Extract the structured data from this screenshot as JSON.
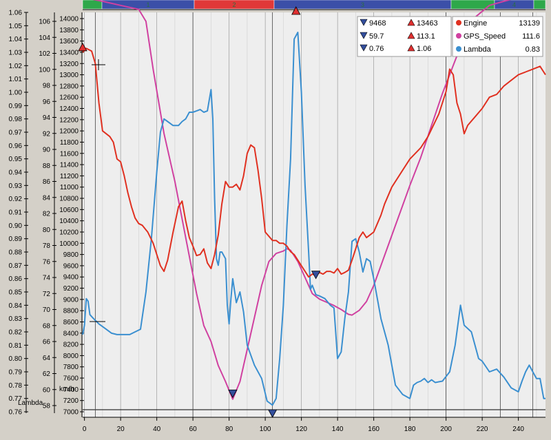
{
  "segments_bar": [
    {
      "label": "1",
      "color": "#3b4fa8"
    },
    {
      "label": "2",
      "color": "#e03838"
    },
    {
      "label": "3",
      "color": "#3b4fa8"
    },
    {
      "label": "4",
      "color": "#3b4fa8"
    }
  ],
  "stats_box": {
    "rows": [
      {
        "min": "9468",
        "max": "13463"
      },
      {
        "min": "59.7",
        "max": "113.1"
      },
      {
        "min": "0.76",
        "max": "1.06"
      }
    ]
  },
  "legend": [
    {
      "name": "Engine",
      "value": "13139",
      "color": "#e03020"
    },
    {
      "name": "GPS_Speed",
      "value": "111.6",
      "color": "#d040a0"
    },
    {
      "name": "Lambda",
      "value": "0.83",
      "color": "#3a8fd0"
    }
  ],
  "axes": {
    "lambda_label": "Lambda",
    "speed_label": "km/h"
  },
  "chart_data": {
    "type": "line",
    "x_ticks": [
      0,
      20,
      40,
      60,
      80,
      100,
      120,
      140,
      160,
      180,
      200,
      220,
      240
    ],
    "xlim": [
      -1,
      255
    ],
    "lambda_axis": {
      "ylim": [
        0.76,
        1.06
      ],
      "ticks": [
        "1.06",
        "1.05",
        "1.04",
        "1.03",
        "1.02",
        "1.01",
        "1.00",
        "0.99",
        "0.98",
        "0.97",
        "0.96",
        "0.95",
        "0.94",
        "0.93",
        "0.92",
        "0.91",
        "0.90",
        "0.89",
        "0.88",
        "0.87",
        "0.86",
        "0.85",
        "0.84",
        "0.83",
        "0.82",
        "0.81",
        "0.80",
        "0.79",
        "0.78",
        "0.77",
        "0.76"
      ]
    },
    "speed_axis": {
      "ylim": [
        57,
        107
      ],
      "ticks": [
        58,
        60,
        62,
        64,
        66,
        68,
        70,
        72,
        74,
        76,
        78,
        80,
        82,
        84,
        86,
        88,
        90,
        92,
        94,
        96,
        98,
        100,
        102,
        104,
        106
      ]
    },
    "engine_axis": {
      "ylim": [
        7000,
        14000
      ],
      "ticks": [
        7000,
        7200,
        7400,
        7600,
        7800,
        8000,
        8200,
        8400,
        8600,
        8800,
        9000,
        9200,
        9400,
        9600,
        9800,
        10000,
        10200,
        10400,
        10600,
        10800,
        11000,
        11200,
        11400,
        11600,
        11800,
        12000,
        12200,
        12400,
        12600,
        12800,
        13000,
        13200,
        13400,
        13600,
        13800,
        14000
      ]
    },
    "segment_dividers": [
      6,
      60,
      104,
      200,
      230,
      248
    ],
    "series": [
      {
        "name": "Engine",
        "color": "#e03020",
        "axis": "engine",
        "points": [
          [
            -1,
            13400
          ],
          [
            1,
            13470
          ],
          [
            4,
            13420
          ],
          [
            6,
            13200
          ],
          [
            8,
            12500
          ],
          [
            10,
            12000
          ],
          [
            14,
            11900
          ],
          [
            16,
            11800
          ],
          [
            18,
            11500
          ],
          [
            20,
            11450
          ],
          [
            22,
            11200
          ],
          [
            24,
            10900
          ],
          [
            26,
            10650
          ],
          [
            28,
            10450
          ],
          [
            30,
            10350
          ],
          [
            32,
            10320
          ],
          [
            35,
            10200
          ],
          [
            38,
            10000
          ],
          [
            40,
            9800
          ],
          [
            42,
            9600
          ],
          [
            44,
            9500
          ],
          [
            46,
            9700
          ],
          [
            49,
            10200
          ],
          [
            52,
            10650
          ],
          [
            54,
            10750
          ],
          [
            56,
            10400
          ],
          [
            58,
            10100
          ],
          [
            60,
            9950
          ],
          [
            62,
            9780
          ],
          [
            64,
            9800
          ],
          [
            66,
            9900
          ],
          [
            68,
            9650
          ],
          [
            70,
            9550
          ],
          [
            72,
            9800
          ],
          [
            74,
            10150
          ],
          [
            76,
            10700
          ],
          [
            78,
            11100
          ],
          [
            80,
            11000
          ],
          [
            82,
            11000
          ],
          [
            84,
            11050
          ],
          [
            86,
            10950
          ],
          [
            88,
            11200
          ],
          [
            90,
            11600
          ],
          [
            92,
            11750
          ],
          [
            94,
            11700
          ],
          [
            96,
            11300
          ],
          [
            98,
            10800
          ],
          [
            100,
            10200
          ],
          [
            104,
            10050
          ],
          [
            106,
            10050
          ],
          [
            108,
            10000
          ],
          [
            110,
            10000
          ],
          [
            112,
            9950
          ],
          [
            114,
            9850
          ],
          [
            116,
            9800
          ],
          [
            118,
            9700
          ],
          [
            120,
            9600
          ],
          [
            122,
            9500
          ],
          [
            124,
            9400
          ],
          [
            126,
            9450
          ],
          [
            128,
            9430
          ],
          [
            130,
            9480
          ],
          [
            132,
            9450
          ],
          [
            134,
            9500
          ],
          [
            136,
            9500
          ],
          [
            138,
            9470
          ],
          [
            140,
            9550
          ],
          [
            142,
            9450
          ],
          [
            144,
            9480
          ],
          [
            146,
            9520
          ],
          [
            148,
            9700
          ],
          [
            150,
            9900
          ],
          [
            152,
            10100
          ],
          [
            154,
            10200
          ],
          [
            156,
            10100
          ],
          [
            158,
            10150
          ],
          [
            160,
            10200
          ],
          [
            162,
            10350
          ],
          [
            164,
            10500
          ],
          [
            166,
            10700
          ],
          [
            170,
            11000
          ],
          [
            176,
            11300
          ],
          [
            180,
            11500
          ],
          [
            186,
            11700
          ],
          [
            190,
            11900
          ],
          [
            196,
            12300
          ],
          [
            200,
            12700
          ],
          [
            202,
            13100
          ],
          [
            204,
            13000
          ],
          [
            206,
            12500
          ],
          [
            208,
            12300
          ],
          [
            210,
            11950
          ],
          [
            212,
            12100
          ],
          [
            216,
            12250
          ],
          [
            220,
            12400
          ],
          [
            224,
            12600
          ],
          [
            228,
            12650
          ],
          [
            232,
            12800
          ],
          [
            236,
            12900
          ],
          [
            240,
            13000
          ],
          [
            244,
            13050
          ],
          [
            248,
            13100
          ],
          [
            252,
            13150
          ],
          [
            255,
            13000
          ]
        ]
      },
      {
        "name": "GPS_Speed",
        "color": "#d040a0",
        "axis": "speed",
        "points": [
          [
            -1,
            109
          ],
          [
            10,
            108.5
          ],
          [
            20,
            108
          ],
          [
            30,
            107.5
          ],
          [
            34,
            106
          ],
          [
            38,
            100
          ],
          [
            44,
            92
          ],
          [
            50,
            86
          ],
          [
            56,
            79
          ],
          [
            62,
            72
          ],
          [
            66,
            68
          ],
          [
            70,
            66
          ],
          [
            74,
            63
          ],
          [
            78,
            61
          ],
          [
            82,
            58.8
          ],
          [
            86,
            61
          ],
          [
            90,
            65
          ],
          [
            94,
            69
          ],
          [
            98,
            73
          ],
          [
            102,
            76
          ],
          [
            106,
            77
          ],
          [
            110,
            77.3
          ],
          [
            112,
            77.6
          ],
          [
            114,
            77.4
          ],
          [
            118,
            76
          ],
          [
            122,
            74
          ],
          [
            126,
            72
          ],
          [
            130,
            71.3
          ],
          [
            134,
            70.9
          ],
          [
            138,
            70.5
          ],
          [
            142,
            70
          ],
          [
            146,
            69.4
          ],
          [
            148,
            69.3
          ],
          [
            152,
            69.9
          ],
          [
            156,
            71
          ],
          [
            160,
            73
          ],
          [
            164,
            75.5
          ],
          [
            168,
            78
          ],
          [
            172,
            80.5
          ],
          [
            176,
            83
          ],
          [
            180,
            85.5
          ],
          [
            186,
            89
          ],
          [
            192,
            93
          ],
          [
            198,
            97
          ],
          [
            204,
            100.5
          ],
          [
            210,
            104
          ],
          [
            216,
            106.5
          ],
          [
            224,
            108
          ],
          [
            232,
            108.5
          ],
          [
            240,
            109
          ],
          [
            250,
            109.5
          ],
          [
            255,
            109.5
          ]
        ]
      },
      {
        "name": "Lambda",
        "color": "#3a8fd0",
        "axis": "lambda",
        "points": [
          [
            -1,
            0.818
          ],
          [
            0,
            0.825
          ],
          [
            1,
            0.845
          ],
          [
            2,
            0.843
          ],
          [
            3,
            0.833
          ],
          [
            5,
            0.83
          ],
          [
            8,
            0.826
          ],
          [
            12,
            0.822
          ],
          [
            15,
            0.819
          ],
          [
            18,
            0.818
          ],
          [
            22,
            0.818
          ],
          [
            25,
            0.818
          ],
          [
            28,
            0.82
          ],
          [
            31,
            0.822
          ],
          [
            34,
            0.85
          ],
          [
            37,
            0.89
          ],
          [
            40,
            0.94
          ],
          [
            42,
            0.97
          ],
          [
            44,
            0.98
          ],
          [
            46,
            0.978
          ],
          [
            49,
            0.975
          ],
          [
            52,
            0.975
          ],
          [
            54,
            0.978
          ],
          [
            56,
            0.98
          ],
          [
            58,
            0.985
          ],
          [
            60,
            0.985
          ],
          [
            62,
            0.986
          ],
          [
            64,
            0.987
          ],
          [
            66,
            0.985
          ],
          [
            68,
            0.986
          ],
          [
            70,
            1.002
          ],
          [
            71,
            0.98
          ],
          [
            72,
            0.92
          ],
          [
            73,
            0.875
          ],
          [
            74,
            0.87
          ],
          [
            75,
            0.88
          ],
          [
            76,
            0.88
          ],
          [
            78,
            0.875
          ],
          [
            79,
            0.84
          ],
          [
            80,
            0.826
          ],
          [
            81,
            0.845
          ],
          [
            82,
            0.86
          ],
          [
            84,
            0.842
          ],
          [
            86,
            0.85
          ],
          [
            88,
            0.835
          ],
          [
            90,
            0.81
          ],
          [
            94,
            0.795
          ],
          [
            98,
            0.785
          ],
          [
            101,
            0.768
          ],
          [
            104,
            0.765
          ],
          [
            106,
            0.77
          ],
          [
            108,
            0.8
          ],
          [
            110,
            0.84
          ],
          [
            112,
            0.9
          ],
          [
            114,
            0.95
          ],
          [
            116,
            1.04
          ],
          [
            118,
            1.045
          ],
          [
            120,
            1.0
          ],
          [
            122,
            0.93
          ],
          [
            124,
            0.88
          ],
          [
            125,
            0.852
          ],
          [
            126,
            0.855
          ],
          [
            128,
            0.848
          ],
          [
            130,
            0.847
          ],
          [
            133,
            0.845
          ],
          [
            136,
            0.84
          ],
          [
            138,
            0.838
          ],
          [
            140,
            0.8
          ],
          [
            142,
            0.805
          ],
          [
            144,
            0.83
          ],
          [
            146,
            0.85
          ],
          [
            148,
            0.888
          ],
          [
            150,
            0.89
          ],
          [
            152,
            0.88
          ],
          [
            154,
            0.865
          ],
          [
            156,
            0.875
          ],
          [
            158,
            0.873
          ],
          [
            160,
            0.86
          ],
          [
            164,
            0.83
          ],
          [
            168,
            0.81
          ],
          [
            172,
            0.78
          ],
          [
            176,
            0.773
          ],
          [
            180,
            0.77
          ],
          [
            182,
            0.78
          ],
          [
            184,
            0.782
          ],
          [
            186,
            0.783
          ],
          [
            188,
            0.785
          ],
          [
            190,
            0.782
          ],
          [
            192,
            0.784
          ],
          [
            194,
            0.782
          ],
          [
            198,
            0.783
          ],
          [
            202,
            0.79
          ],
          [
            205,
            0.81
          ],
          [
            208,
            0.84
          ],
          [
            210,
            0.825
          ],
          [
            214,
            0.82
          ],
          [
            218,
            0.8
          ],
          [
            220,
            0.798
          ],
          [
            224,
            0.79
          ],
          [
            228,
            0.792
          ],
          [
            232,
            0.786
          ],
          [
            236,
            0.778
          ],
          [
            240,
            0.775
          ],
          [
            242,
            0.783
          ],
          [
            244,
            0.79
          ],
          [
            246,
            0.795
          ],
          [
            248,
            0.79
          ],
          [
            250,
            0.785
          ],
          [
            252,
            0.785
          ],
          [
            254,
            0.77
          ],
          [
            255,
            0.77
          ]
        ]
      }
    ],
    "markers": [
      {
        "series": "Engine",
        "x": -1,
        "y": 13463,
        "kind": "max"
      },
      {
        "series": "Lambda",
        "x": 117,
        "y": 1.06,
        "kind": "max"
      },
      {
        "series": "GPS_Speed",
        "x": 82,
        "y": 59.7,
        "kind": "min"
      },
      {
        "series": "Lambda",
        "x": 104,
        "y": 0.76,
        "kind": "min"
      },
      {
        "series": "Engine",
        "x": 128,
        "y": 9468,
        "kind": "min"
      }
    ]
  }
}
